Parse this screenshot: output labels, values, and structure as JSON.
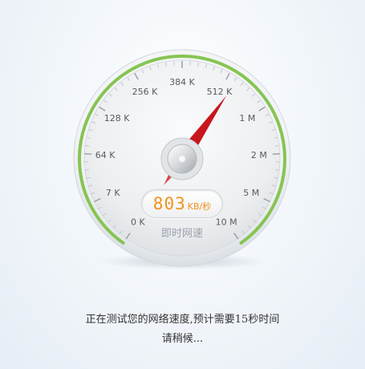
{
  "speed_test": {
    "scale_labels": [
      "0 K",
      "7 K",
      "64 K",
      "128 K",
      "256 K",
      "384 K",
      "512 K",
      "1 M",
      "2 M",
      "5 M",
      "10 M"
    ],
    "speed_value": "803",
    "speed_unit": "KB/秒",
    "mode_label": "即时网速",
    "needle_reading": "512 K",
    "status_line_1": "正在测试您的网络速度,预计需要15秒时间",
    "status_line_2": "请稍候..."
  },
  "colors": {
    "accent_green": "#86c453",
    "needle_red": "#c8161d",
    "readout_orange": "#f0931a"
  }
}
